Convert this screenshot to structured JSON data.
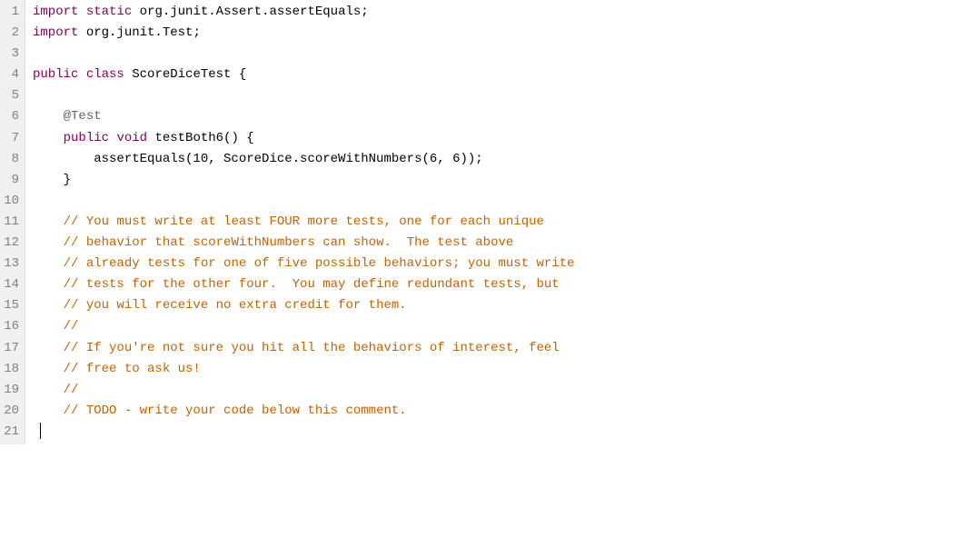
{
  "lines": [
    {
      "num": "1",
      "segments": [
        {
          "cls": "kw-import",
          "text": "import"
        },
        {
          "cls": "plain",
          "text": " "
        },
        {
          "cls": "kw-static",
          "text": "static"
        },
        {
          "cls": "plain",
          "text": " org.junit.Assert.assertEquals;"
        }
      ]
    },
    {
      "num": "2",
      "segments": [
        {
          "cls": "kw-import",
          "text": "import"
        },
        {
          "cls": "plain",
          "text": " org.junit.Test;"
        }
      ]
    },
    {
      "num": "3",
      "segments": []
    },
    {
      "num": "4",
      "segments": [
        {
          "cls": "kw-public",
          "text": "public"
        },
        {
          "cls": "plain",
          "text": " "
        },
        {
          "cls": "kw-class",
          "text": "class"
        },
        {
          "cls": "plain",
          "text": " ScoreDiceTest {"
        }
      ]
    },
    {
      "num": "5",
      "segments": []
    },
    {
      "num": "6",
      "segments": [
        {
          "cls": "plain",
          "text": "    "
        },
        {
          "cls": "annotation",
          "text": "@Test"
        }
      ]
    },
    {
      "num": "7",
      "segments": [
        {
          "cls": "plain",
          "text": "    "
        },
        {
          "cls": "kw-public",
          "text": "public"
        },
        {
          "cls": "plain",
          "text": " "
        },
        {
          "cls": "kw-void",
          "text": "void"
        },
        {
          "cls": "plain",
          "text": " testBoth6() {"
        }
      ]
    },
    {
      "num": "8",
      "segments": [
        {
          "cls": "plain",
          "text": "        assertEquals(10, ScoreDice.scoreWithNumbers(6, 6));"
        }
      ]
    },
    {
      "num": "9",
      "segments": [
        {
          "cls": "plain",
          "text": "    }"
        }
      ]
    },
    {
      "num": "10",
      "segments": []
    },
    {
      "num": "11",
      "segments": [
        {
          "cls": "plain",
          "text": "    "
        },
        {
          "cls": "comment",
          "text": "// You must write at least FOUR more tests, one for each unique"
        }
      ]
    },
    {
      "num": "12",
      "segments": [
        {
          "cls": "plain",
          "text": "    "
        },
        {
          "cls": "comment",
          "text": "// behavior that scoreWithNumbers can show.  The test above"
        }
      ]
    },
    {
      "num": "13",
      "segments": [
        {
          "cls": "plain",
          "text": "    "
        },
        {
          "cls": "comment",
          "text": "// already tests for one of five possible behaviors; you must write"
        }
      ]
    },
    {
      "num": "14",
      "segments": [
        {
          "cls": "plain",
          "text": "    "
        },
        {
          "cls": "comment",
          "text": "// tests for the other four.  You may define redundant tests, but"
        }
      ]
    },
    {
      "num": "15",
      "segments": [
        {
          "cls": "plain",
          "text": "    "
        },
        {
          "cls": "comment",
          "text": "// you will receive no extra credit for them."
        }
      ]
    },
    {
      "num": "16",
      "segments": [
        {
          "cls": "plain",
          "text": "    "
        },
        {
          "cls": "comment",
          "text": "//"
        }
      ]
    },
    {
      "num": "17",
      "segments": [
        {
          "cls": "plain",
          "text": "    "
        },
        {
          "cls": "comment",
          "text": "// If you're not sure you hit all the behaviors of interest, feel"
        }
      ]
    },
    {
      "num": "18",
      "segments": [
        {
          "cls": "plain",
          "text": "    "
        },
        {
          "cls": "comment",
          "text": "// free to ask us!"
        }
      ]
    },
    {
      "num": "19",
      "segments": [
        {
          "cls": "plain",
          "text": "    "
        },
        {
          "cls": "comment",
          "text": "//"
        }
      ]
    },
    {
      "num": "20",
      "segments": [
        {
          "cls": "plain",
          "text": "    "
        },
        {
          "cls": "comment",
          "text": "// TODO - write your code below this comment."
        }
      ]
    },
    {
      "num": "21",
      "segments": [
        {
          "cls": "plain",
          "text": " "
        }
      ],
      "cursor": true
    }
  ]
}
